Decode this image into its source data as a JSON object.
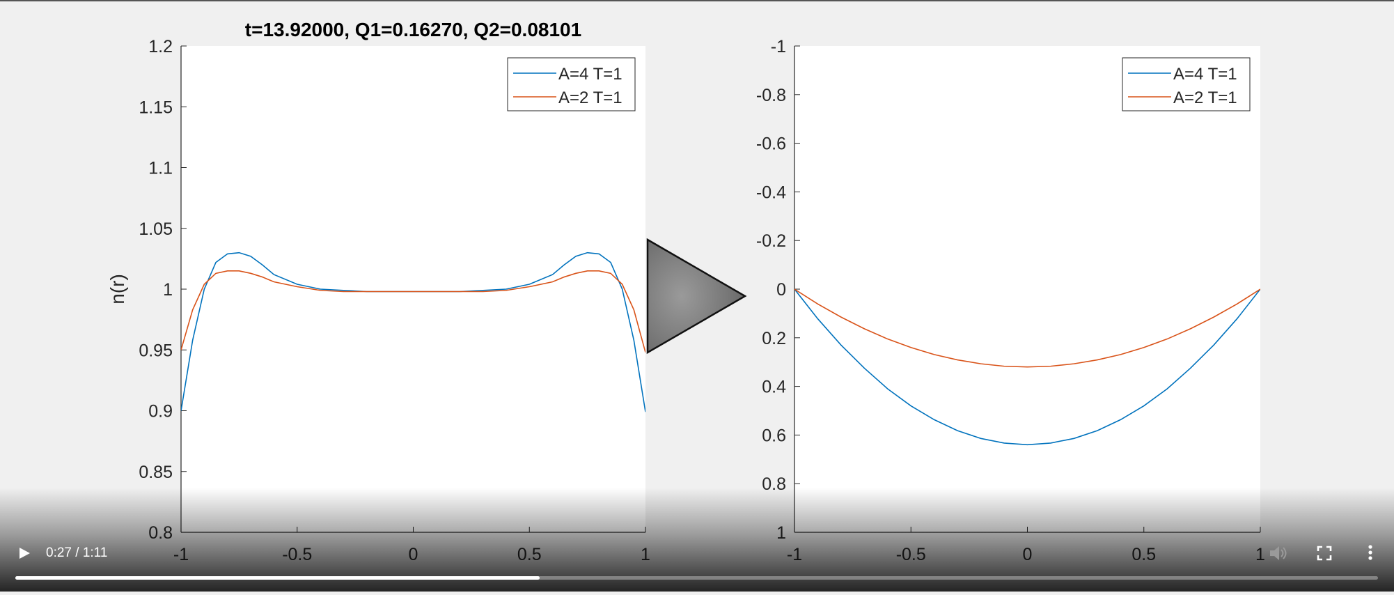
{
  "figure": {
    "title": "t=13.92000, Q1=0.16270, Q2=0.08101"
  },
  "chart_data": [
    {
      "type": "line",
      "title": "t=13.92000, Q1=0.16270, Q2=0.08101",
      "xlabel": "",
      "ylabel": "n(r)",
      "xlim": [
        -1,
        1
      ],
      "ylim": [
        0.8,
        1.2
      ],
      "y_reversed": false,
      "grid": false,
      "legend": "top-right",
      "x_ticks": [
        "-1",
        "-0.5",
        "0",
        "0.5",
        "1"
      ],
      "y_ticks": [
        "0.8",
        "0.85",
        "0.9",
        "0.95",
        "1",
        "1.05",
        "1.1",
        "1.15",
        "1.2"
      ],
      "series": [
        {
          "name": "A=4 T=1",
          "color": "#0072bd",
          "x": [
            -1,
            -0.95,
            -0.9,
            -0.85,
            -0.8,
            -0.75,
            -0.7,
            -0.65,
            -0.6,
            -0.5,
            -0.4,
            -0.3,
            -0.2,
            0,
            0.2,
            0.3,
            0.4,
            0.5,
            0.6,
            0.65,
            0.7,
            0.75,
            0.8,
            0.85,
            0.9,
            0.95,
            1
          ],
          "y": [
            0.9,
            0.958,
            1.0,
            1.022,
            1.029,
            1.03,
            1.027,
            1.02,
            1.012,
            1.004,
            1.0,
            0.999,
            0.998,
            0.998,
            0.998,
            0.999,
            1.0,
            1.004,
            1.012,
            1.02,
            1.027,
            1.03,
            1.029,
            1.022,
            1.0,
            0.958,
            0.899
          ]
        },
        {
          "name": "A=2 T=1",
          "color": "#d95319",
          "x": [
            -1,
            -0.95,
            -0.9,
            -0.85,
            -0.8,
            -0.75,
            -0.7,
            -0.65,
            -0.6,
            -0.5,
            -0.4,
            -0.3,
            -0.2,
            0,
            0.2,
            0.3,
            0.4,
            0.5,
            0.6,
            0.65,
            0.7,
            0.75,
            0.8,
            0.85,
            0.9,
            0.95,
            1
          ],
          "y": [
            0.95,
            0.983,
            1.004,
            1.013,
            1.015,
            1.015,
            1.013,
            1.01,
            1.006,
            1.002,
            0.999,
            0.998,
            0.998,
            0.998,
            0.998,
            0.998,
            0.999,
            1.002,
            1.006,
            1.01,
            1.013,
            1.015,
            1.015,
            1.013,
            1.004,
            0.983,
            0.948
          ]
        }
      ]
    },
    {
      "type": "line",
      "title": "",
      "xlabel": "",
      "ylabel": "",
      "xlim": [
        -1,
        1
      ],
      "ylim": [
        -1,
        1
      ],
      "y_reversed": true,
      "grid": false,
      "legend": "top-right",
      "x_ticks": [
        "-1",
        "-0.5",
        "0",
        "0.5",
        "1"
      ],
      "y_ticks": [
        "-1",
        "-0.8",
        "-0.6",
        "-0.4",
        "-0.2",
        "0",
        "0.2",
        "0.4",
        "0.6",
        "0.8",
        "1"
      ],
      "series": [
        {
          "name": "A=4 T=1",
          "color": "#0072bd",
          "x": [
            -1,
            -0.9,
            -0.8,
            -0.7,
            -0.6,
            -0.5,
            -0.4,
            -0.3,
            -0.2,
            -0.1,
            0,
            0.1,
            0.2,
            0.3,
            0.4,
            0.5,
            0.6,
            0.7,
            0.8,
            0.9,
            1
          ],
          "y": [
            0,
            0.122,
            0.23,
            0.325,
            0.41,
            0.48,
            0.537,
            0.582,
            0.614,
            0.633,
            0.64,
            0.633,
            0.614,
            0.582,
            0.537,
            0.48,
            0.41,
            0.325,
            0.23,
            0.122,
            0
          ]
        },
        {
          "name": "A=2 T=1",
          "color": "#d95319",
          "x": [
            -1,
            -0.9,
            -0.8,
            -0.7,
            -0.6,
            -0.5,
            -0.4,
            -0.3,
            -0.2,
            -0.1,
            0,
            0.1,
            0.2,
            0.3,
            0.4,
            0.5,
            0.6,
            0.7,
            0.8,
            0.9,
            1
          ],
          "y": [
            0,
            0.061,
            0.115,
            0.163,
            0.205,
            0.24,
            0.269,
            0.291,
            0.307,
            0.317,
            0.32,
            0.317,
            0.307,
            0.291,
            0.269,
            0.24,
            0.205,
            0.163,
            0.115,
            0.061,
            0
          ]
        }
      ]
    }
  ],
  "player": {
    "current_time": "0:27",
    "separator": " / ",
    "duration": "1:11",
    "progress": 0.385,
    "icons": {
      "play": "play-icon",
      "big_play": "big-play-overlay-icon",
      "volume": "volume-muted-icon",
      "fullscreen": "fullscreen-icon",
      "more": "more-vert-icon"
    }
  }
}
